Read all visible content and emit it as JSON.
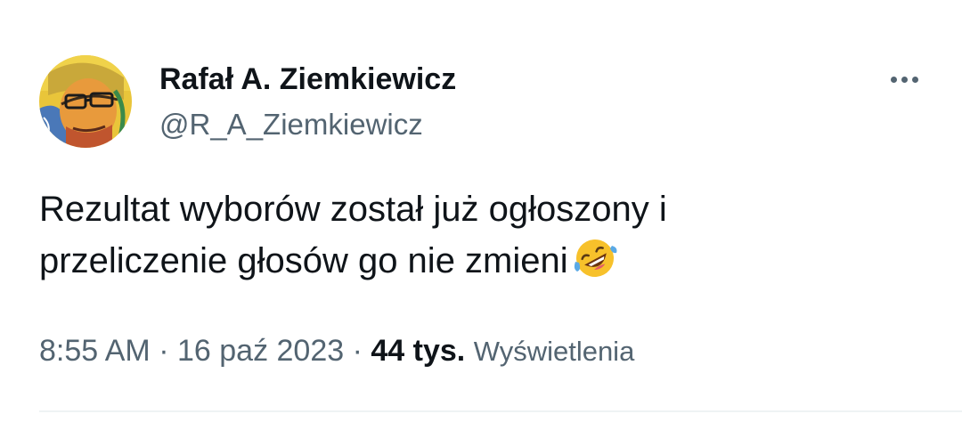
{
  "author": {
    "display_name": "Rafał A. Ziemkiewicz",
    "handle": "@R_A_Ziemkiewicz"
  },
  "tweet": {
    "text_line_1": "Rezultat wyborów został już ogłoszony i",
    "text_line_2": "przeliczenie głosów go nie zmieni",
    "emoji": "rolling-on-the-floor-laughing"
  },
  "meta": {
    "time": "8:55 AM",
    "separator": "·",
    "date": "16 paź 2023",
    "views_count": "44 tys.",
    "views_label": "Wyświetlenia"
  },
  "icons": {
    "more": "more-options-icon"
  },
  "colors": {
    "primary_text": "#0f1419",
    "secondary_text": "#536471",
    "divider": "#eff3f4"
  }
}
